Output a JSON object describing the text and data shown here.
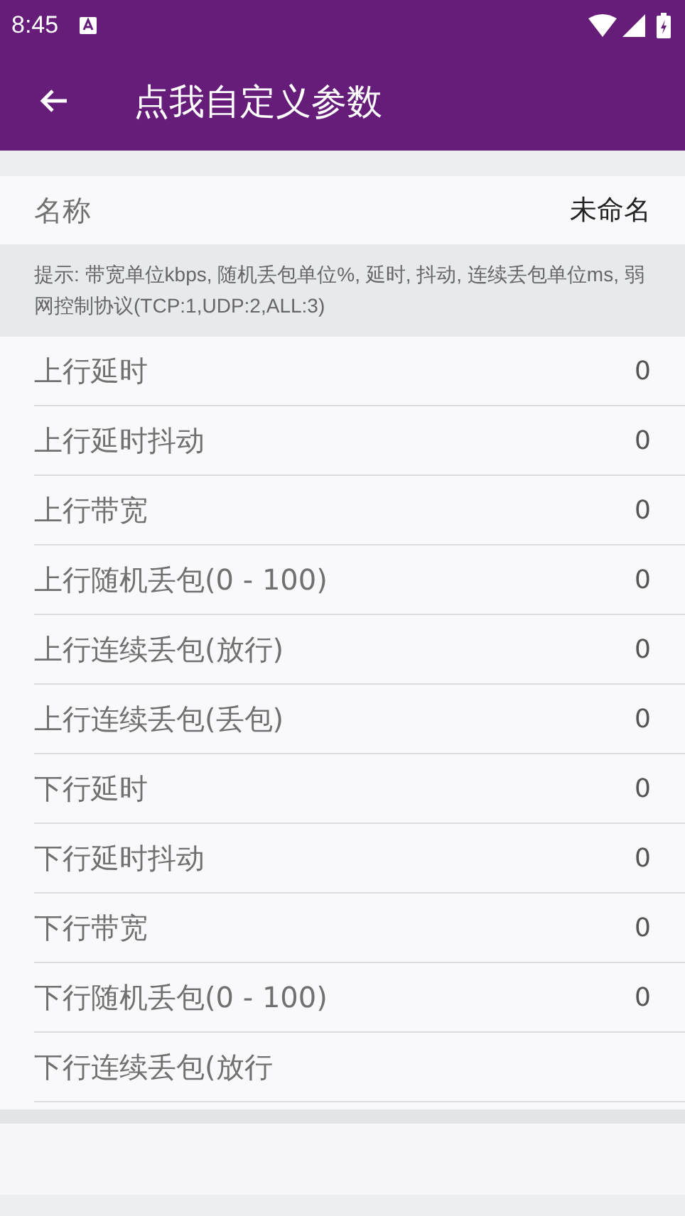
{
  "status_bar": {
    "time": "8:45"
  },
  "toolbar": {
    "title": "点我自定义参数"
  },
  "name_row": {
    "label": "名称",
    "value": "未命名"
  },
  "hint": "提示: 带宽单位kbps, 随机丢包单位%, 延时, 抖动, 连续丢包单位ms, 弱网控制协议(TCP:1,UDP:2,ALL:3)",
  "params": [
    {
      "label": "上行延时",
      "value": "0"
    },
    {
      "label": "上行延时抖动",
      "value": "0"
    },
    {
      "label": "上行带宽",
      "value": "0"
    },
    {
      "label": "上行随机丢包(0 - 100)",
      "value": "0"
    },
    {
      "label": "上行连续丢包(放行)",
      "value": "0"
    },
    {
      "label": "上行连续丢包(丢包)",
      "value": "0"
    },
    {
      "label": "下行延时",
      "value": "0"
    },
    {
      "label": "下行延时抖动",
      "value": "0"
    },
    {
      "label": "下行带宽",
      "value": "0"
    },
    {
      "label": "下行随机丢包(0 - 100)",
      "value": "0"
    },
    {
      "label": "下行连续丢包(放行"
    }
  ]
}
